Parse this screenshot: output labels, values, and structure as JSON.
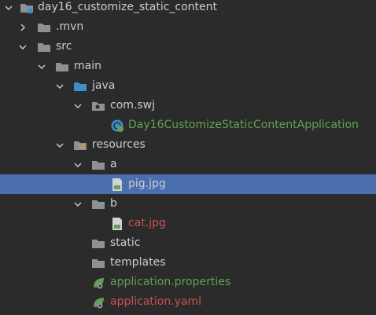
{
  "tree": {
    "root": {
      "label": "day16_customize_static_content",
      "expanded": true,
      "icon": "module-folder-icon"
    },
    "items": [
      {
        "label": ".mvn",
        "expanded": false,
        "icon": "folder-icon",
        "color": "#c9cdd1"
      },
      {
        "label": "src",
        "expanded": true,
        "icon": "folder-icon",
        "color": "#c9cdd1"
      },
      {
        "label": "main",
        "expanded": true,
        "icon": "folder-icon",
        "color": "#c9cdd1"
      },
      {
        "label": "java",
        "expanded": true,
        "icon": "source-folder-icon",
        "color": "#c9cdd1"
      },
      {
        "label": "com.swj",
        "expanded": true,
        "icon": "package-icon",
        "color": "#c9cdd1"
      },
      {
        "label": "Day16CustomizeStaticContentApplication",
        "icon": "spring-boot-class-icon",
        "color": "#62a053"
      },
      {
        "label": "resources",
        "expanded": true,
        "icon": "resources-folder-icon",
        "color": "#c9cdd1"
      },
      {
        "label": "a",
        "expanded": true,
        "icon": "folder-icon",
        "color": "#c9cdd1"
      },
      {
        "label": "pig.jpg",
        "icon": "image-file-icon",
        "color": "#c9cdd1",
        "selected": true
      },
      {
        "label": "b",
        "expanded": true,
        "icon": "folder-icon",
        "color": "#c9cdd1"
      },
      {
        "label": "cat.jpg",
        "icon": "image-file-icon",
        "color": "#c7544f"
      },
      {
        "label": "static",
        "icon": "folder-icon",
        "color": "#c9cdd1"
      },
      {
        "label": "templates",
        "icon": "folder-icon",
        "color": "#c9cdd1"
      },
      {
        "label": "application.properties",
        "icon": "spring-config-icon",
        "color": "#62a053"
      },
      {
        "label": "application.yaml",
        "icon": "spring-config-icon",
        "color": "#c7544f"
      }
    ]
  },
  "colors": {
    "background": "#2b2b2b",
    "selection": "#4b6eaf",
    "text": "#c9cdd1",
    "vcs_added": "#62a053",
    "vcs_unversioned": "#c7544f",
    "folder": "#8c9196",
    "source_folder": "#3d8ec9"
  }
}
